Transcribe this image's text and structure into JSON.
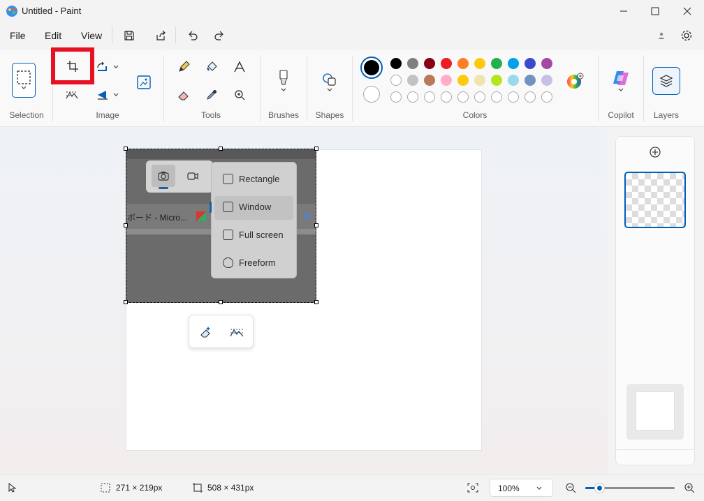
{
  "app": {
    "title": "Untitled - Paint"
  },
  "menu": {
    "file": "File",
    "edit": "Edit",
    "view": "View"
  },
  "ribbon": {
    "groups": {
      "selection": "Selection",
      "image": "Image",
      "tools": "Tools",
      "brushes": "Brushes",
      "shapes": "Shapes",
      "colors": "Colors",
      "copilot": "Copilot",
      "layers": "Layers"
    }
  },
  "colors": {
    "primary": "#000000",
    "secondary": "#ffffff",
    "row1": [
      "#000000",
      "#7f7f7f",
      "#880015",
      "#ed1c24",
      "#ff7f27",
      "#ffc90e",
      "#22b14c",
      "#00a2e8",
      "#3f48cc",
      "#a349a4"
    ],
    "row2": [
      "#ffffff",
      "#c3c3c3",
      "#b97a57",
      "#ffaec9",
      "#ffc90e",
      "#efe4b0",
      "#b5e61d",
      "#99d9ea",
      "#7092be",
      "#c8bfe7"
    ],
    "highlight": "#e81123",
    "accent": "#005fb8"
  },
  "snip_menu": {
    "items": [
      "Rectangle",
      "Window",
      "Full screen",
      "Freeform"
    ],
    "tab_text": "ボード - Micro..."
  },
  "status": {
    "selection_size": "271 × 219px",
    "canvas_size": "508 × 431px",
    "zoom": "100%"
  }
}
